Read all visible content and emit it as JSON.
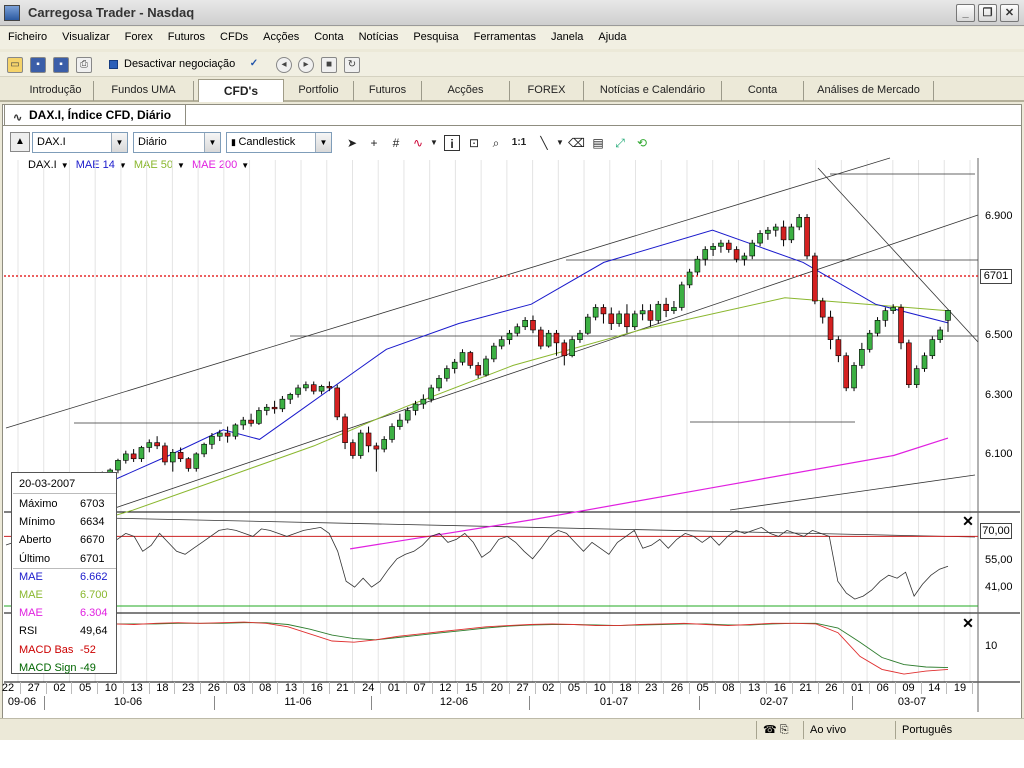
{
  "window": {
    "title": "Carregosa Trader - Nasdaq"
  },
  "menu": [
    "Ficheiro",
    "Visualizar",
    "Forex",
    "Futuros",
    "CFDs",
    "Acções",
    "Conta",
    "Notícias",
    "Pesquisa",
    "Ferramentas",
    "Janela",
    "Ajuda"
  ],
  "toolbar": {
    "deactivate_label": "Desactivar negociação"
  },
  "main_tabs": [
    "Introdução",
    "Fundos UMA",
    "CFD's",
    "Portfolio",
    "Futuros",
    "Acções",
    "FOREX",
    "Notícias e Calendário",
    "Conta",
    "Análises de Mercado"
  ],
  "active_tab": "CFD's",
  "chart_window": {
    "tab_title": "DAX.I, Índice CFD, Diário",
    "symbol": "DAX.I",
    "period": "Diário",
    "style": "Candlestick"
  },
  "legend": [
    {
      "label": "DAX.I",
      "color": "#000000"
    },
    {
      "label": "MAE 14",
      "color": "#1a1acc"
    },
    {
      "label": "MAE 50",
      "color": "#8ab72e"
    },
    {
      "label": "MAE 200",
      "color": "#e020e0"
    }
  ],
  "info": {
    "date": "20-03-2007",
    "rows": [
      {
        "label": "Máximo",
        "value": "6703",
        "color": "#000000"
      },
      {
        "label": "Mínimo",
        "value": "6634",
        "color": "#000000"
      },
      {
        "label": "Aberto",
        "value": "6670",
        "color": "#000000"
      },
      {
        "label": "Último",
        "value": "6701",
        "color": "#000000"
      },
      {
        "label": "MAE",
        "value": "6.662",
        "color": "#1a1acc"
      },
      {
        "label": "MAE",
        "value": "6.700",
        "color": "#8ab72e"
      },
      {
        "label": "MAE",
        "value": "6.304",
        "color": "#e020e0"
      },
      {
        "label": "RSI",
        "value": "49,64",
        "color": "#000000"
      },
      {
        "label": "MACD Bas",
        "value": "-52",
        "color": "#cc0000"
      },
      {
        "label": "MACD Sign",
        "value": "-49",
        "color": "#006600"
      }
    ]
  },
  "last_price_label": "6701",
  "rsi_level_label": "70,00",
  "price_axis": [
    "6.900",
    "6.700",
    "6.500",
    "6.300",
    "6.100"
  ],
  "rsi_axis": [
    "55,00",
    "41,00"
  ],
  "macd_axis": [
    "10"
  ],
  "date_axis": {
    "days": [
      "22",
      "27",
      "02",
      "05",
      "10",
      "13",
      "18",
      "23",
      "26",
      "03",
      "08",
      "13",
      "16",
      "21",
      "24",
      "01",
      "07",
      "12",
      "15",
      "20",
      "27",
      "02",
      "05",
      "10",
      "18",
      "23",
      "26",
      "05",
      "08",
      "13",
      "16",
      "21",
      "26",
      "01",
      "06",
      "09",
      "14",
      "19"
    ],
    "months": [
      "09-06",
      "10-06",
      "11-06",
      "12-06",
      "01-07",
      "02-07",
      "03-07"
    ]
  },
  "status": {
    "live": "Ao vivo",
    "language": "Português"
  },
  "colors": {
    "up": "#3cb043",
    "down": "#d42020",
    "last_price_line": "#e00000",
    "macd_base": "#e03030",
    "macd_signal": "#2e7d2e"
  },
  "chart_data": {
    "type": "candlestick",
    "symbol": "DAX.I",
    "title": "DAX.I, Índice CFD, Diário",
    "ylim": [
      6000,
      7050
    ],
    "y_ticks": [
      6100,
      6300,
      6500,
      6700,
      6900
    ],
    "last_value": 6701,
    "ohlc": [
      [
        6020,
        6040,
        6005,
        6035
      ],
      [
        6035,
        6055,
        6020,
        6045
      ],
      [
        6045,
        6075,
        6035,
        6070
      ],
      [
        6070,
        6090,
        6055,
        6080
      ],
      [
        6080,
        6110,
        6070,
        6105
      ],
      [
        6105,
        6130,
        6090,
        6125
      ],
      [
        6125,
        6150,
        6110,
        6140
      ],
      [
        6140,
        6170,
        6130,
        6160
      ],
      [
        6160,
        6175,
        6120,
        6130
      ],
      [
        6130,
        6185,
        6125,
        6180
      ],
      [
        6180,
        6200,
        6160,
        6170
      ],
      [
        6170,
        6210,
        6165,
        6205
      ],
      [
        6205,
        6240,
        6195,
        6235
      ],
      [
        6235,
        6265,
        6225,
        6255
      ],
      [
        6255,
        6270,
        6230,
        6240
      ],
      [
        6240,
        6280,
        6230,
        6275
      ],
      [
        6275,
        6300,
        6260,
        6290
      ],
      [
        6290,
        6310,
        6270,
        6280
      ],
      [
        6280,
        6290,
        6220,
        6230
      ],
      [
        6230,
        6270,
        6200,
        6260
      ],
      [
        6260,
        6275,
        6230,
        6240
      ],
      [
        6240,
        6245,
        6200,
        6210
      ],
      [
        6210,
        6260,
        6200,
        6255
      ],
      [
        6255,
        6290,
        6245,
        6285
      ],
      [
        6285,
        6320,
        6270,
        6310
      ],
      [
        6310,
        6330,
        6295,
        6320
      ],
      [
        6320,
        6340,
        6290,
        6310
      ],
      [
        6310,
        6350,
        6300,
        6345
      ],
      [
        6345,
        6370,
        6330,
        6360
      ],
      [
        6360,
        6380,
        6340,
        6350
      ],
      [
        6350,
        6400,
        6345,
        6390
      ],
      [
        6390,
        6410,
        6375,
        6400
      ],
      [
        6400,
        6420,
        6380,
        6395
      ],
      [
        6395,
        6435,
        6385,
        6425
      ],
      [
        6425,
        6445,
        6410,
        6440
      ],
      [
        6440,
        6470,
        6430,
        6460
      ],
      [
        6460,
        6480,
        6450,
        6470
      ],
      [
        6470,
        6480,
        6440,
        6450
      ],
      [
        6450,
        6470,
        6440,
        6465
      ],
      [
        6465,
        6480,
        6450,
        6460
      ],
      [
        6460,
        6470,
        6360,
        6370
      ],
      [
        6370,
        6380,
        6270,
        6290
      ],
      [
        6290,
        6300,
        6240,
        6250
      ],
      [
        6250,
        6330,
        6240,
        6320
      ],
      [
        6320,
        6340,
        6260,
        6280
      ],
      [
        6280,
        6290,
        6200,
        6270
      ],
      [
        6270,
        6310,
        6260,
        6300
      ],
      [
        6300,
        6350,
        6290,
        6340
      ],
      [
        6340,
        6380,
        6330,
        6360
      ],
      [
        6360,
        6400,
        6350,
        6390
      ],
      [
        6390,
        6420,
        6375,
        6410
      ],
      [
        6410,
        6440,
        6395,
        6425
      ],
      [
        6425,
        6470,
        6415,
        6460
      ],
      [
        6460,
        6500,
        6450,
        6490
      ],
      [
        6490,
        6530,
        6480,
        6520
      ],
      [
        6520,
        6550,
        6505,
        6540
      ],
      [
        6540,
        6580,
        6530,
        6570
      ],
      [
        6570,
        6575,
        6520,
        6530
      ],
      [
        6530,
        6540,
        6490,
        6500
      ],
      [
        6500,
        6560,
        6495,
        6550
      ],
      [
        6550,
        6600,
        6540,
        6590
      ],
      [
        6590,
        6620,
        6580,
        6610
      ],
      [
        6610,
        6640,
        6595,
        6630
      ],
      [
        6630,
        6660,
        6620,
        6650
      ],
      [
        6650,
        6680,
        6640,
        6670
      ],
      [
        6670,
        6685,
        6630,
        6640
      ],
      [
        6640,
        6650,
        6580,
        6590
      ],
      [
        6590,
        6640,
        6585,
        6630
      ],
      [
        6630,
        6640,
        6560,
        6600
      ],
      [
        6600,
        6610,
        6530,
        6560
      ],
      [
        6560,
        6620,
        6555,
        6610
      ],
      [
        6610,
        6640,
        6600,
        6630
      ],
      [
        6630,
        6690,
        6625,
        6680
      ],
      [
        6680,
        6720,
        6670,
        6710
      ],
      [
        6710,
        6720,
        6660,
        6690
      ],
      [
        6690,
        6710,
        6640,
        6660
      ],
      [
        6660,
        6700,
        6650,
        6690
      ],
      [
        6690,
        6720,
        6630,
        6650
      ],
      [
        6650,
        6700,
        6640,
        6690
      ],
      [
        6690,
        6720,
        6670,
        6700
      ],
      [
        6700,
        6720,
        6650,
        6670
      ],
      [
        6670,
        6730,
        6660,
        6720
      ],
      [
        6720,
        6740,
        6680,
        6700
      ],
      [
        6700,
        6730,
        6690,
        6710
      ],
      [
        6710,
        6790,
        6700,
        6780
      ],
      [
        6780,
        6830,
        6770,
        6820
      ],
      [
        6820,
        6870,
        6810,
        6860
      ],
      [
        6860,
        6900,
        6840,
        6890
      ],
      [
        6890,
        6910,
        6870,
        6900
      ],
      [
        6900,
        6920,
        6880,
        6910
      ],
      [
        6910,
        6920,
        6880,
        6890
      ],
      [
        6890,
        6900,
        6850,
        6860
      ],
      [
        6860,
        6880,
        6840,
        6870
      ],
      [
        6870,
        6920,
        6860,
        6910
      ],
      [
        6910,
        6950,
        6900,
        6940
      ],
      [
        6940,
        6960,
        6920,
        6950
      ],
      [
        6950,
        6970,
        6930,
        6960
      ],
      [
        6960,
        6980,
        6900,
        6920
      ],
      [
        6920,
        6970,
        6910,
        6960
      ],
      [
        6960,
        7000,
        6950,
        6990
      ],
      [
        6990,
        7000,
        6860,
        6870
      ],
      [
        6870,
        6880,
        6720,
        6730
      ],
      [
        6730,
        6740,
        6660,
        6680
      ],
      [
        6680,
        6700,
        6580,
        6610
      ],
      [
        6610,
        6620,
        6540,
        6560
      ],
      [
        6560,
        6570,
        6450,
        6460
      ],
      [
        6460,
        6540,
        6450,
        6530
      ],
      [
        6530,
        6600,
        6520,
        6580
      ],
      [
        6580,
        6640,
        6570,
        6630
      ],
      [
        6630,
        6680,
        6620,
        6670
      ],
      [
        6670,
        6710,
        6650,
        6700
      ],
      [
        6700,
        6720,
        6690,
        6710
      ],
      [
        6710,
        6720,
        6580,
        6600
      ],
      [
        6600,
        6610,
        6460,
        6470
      ],
      [
        6470,
        6530,
        6460,
        6520
      ],
      [
        6520,
        6570,
        6510,
        6560
      ],
      [
        6560,
        6620,
        6550,
        6610
      ],
      [
        6610,
        6650,
        6600,
        6640
      ],
      [
        6670,
        6703,
        6634,
        6701
      ]
    ],
    "mae14_points": [
      [
        6060,
        0
      ],
      [
        6150,
        20
      ],
      [
        6250,
        40
      ],
      [
        6330,
        55
      ],
      [
        6300,
        65
      ],
      [
        6380,
        75
      ],
      [
        6500,
        90
      ],
      [
        6580,
        100
      ],
      [
        6660,
        120
      ],
      [
        6720,
        140
      ],
      [
        6850,
        160
      ],
      [
        6950,
        190
      ],
      [
        6850,
        215
      ],
      [
        6720,
        235
      ],
      [
        6662,
        255
      ]
    ],
    "mae50_points": [
      [
        5980,
        0
      ],
      [
        6080,
        30
      ],
      [
        6180,
        55
      ],
      [
        6280,
        80
      ],
      [
        6400,
        105
      ],
      [
        6530,
        135
      ],
      [
        6640,
        170
      ],
      [
        6740,
        210
      ],
      [
        6700,
        255
      ]
    ],
    "mae200_points": [
      [
        5960,
        90
      ],
      [
        6050,
        140
      ],
      [
        6150,
        190
      ],
      [
        6250,
        240
      ],
      [
        6304,
        255
      ]
    ],
    "rsi_ylim": [
      20,
      85
    ],
    "rsi_level": 70,
    "rsi_values": [
      62,
      66,
      70,
      74,
      72,
      63,
      70,
      72,
      65,
      72,
      70,
      68,
      72,
      70,
      60,
      64,
      72,
      66,
      60,
      58,
      62,
      66,
      70,
      74,
      75,
      74,
      72,
      70,
      75,
      74,
      72,
      70,
      72,
      74,
      75,
      76,
      72,
      60,
      40,
      36,
      42,
      36,
      40,
      48,
      55,
      58,
      60,
      64,
      70,
      72,
      66,
      68,
      72,
      66,
      56,
      60,
      68,
      70,
      66,
      60,
      55,
      62,
      70,
      74,
      72,
      66,
      60,
      66,
      62,
      58,
      66,
      70,
      74,
      62,
      64,
      68,
      62,
      68,
      72,
      70,
      66,
      70,
      64,
      70,
      74,
      72,
      74,
      76,
      72,
      70,
      74,
      72,
      70,
      74,
      72,
      70,
      40,
      32,
      28,
      30,
      34,
      40,
      44,
      42,
      46,
      30,
      38,
      44,
      48,
      50
    ],
    "macd_ylim": [
      -70,
      40
    ],
    "macd_base": [
      20,
      22,
      24,
      26,
      25,
      24,
      26,
      27,
      26,
      27,
      28,
      26,
      20,
      8,
      -4,
      -6,
      -2,
      4,
      8,
      12,
      16,
      20,
      22,
      24,
      25,
      24,
      22,
      22,
      24,
      25,
      26,
      24,
      22,
      24,
      26,
      26,
      25,
      10,
      -30,
      -52,
      -60,
      -55,
      -52
    ],
    "macd_signal": [
      18,
      20,
      22,
      24,
      25,
      25,
      25,
      26,
      26,
      26,
      27,
      27,
      24,
      16,
      6,
      0,
      -2,
      2,
      6,
      10,
      14,
      18,
      21,
      23,
      24,
      24,
      23,
      22,
      23,
      24,
      25,
      25,
      23,
      23,
      25,
      26,
      26,
      18,
      -6,
      -32,
      -44,
      -48,
      -49
    ]
  }
}
